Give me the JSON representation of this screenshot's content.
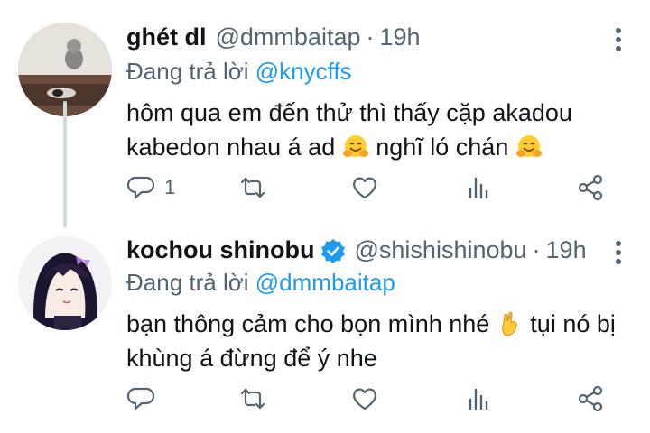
{
  "tweets": [
    {
      "name": "ghét dl",
      "handle": "@dmmbaitap",
      "separator": "·",
      "time": "19h",
      "reply_prefix": "Đang trả lời ",
      "reply_to": "@knycffs",
      "text_part1": "hôm qua em đến thử thì thấy cặp akadou kabedon nhau á ad ",
      "text_part2": " nghĩ ló chán ",
      "emoji": "hugging-face-icon",
      "reply_count": "1",
      "verified": false
    },
    {
      "name": "kochou shinobu",
      "handle": "@shishishinobu",
      "separator": "·",
      "time": "19h",
      "reply_prefix": "Đang trả lời ",
      "reply_to": "@dmmbaitap",
      "text_part1": "bạn thông cảm cho bọn mình nhé ",
      "text_part2": " tụi nó bị khùng á đừng để ý nhe",
      "emoji": "crossed-fingers-icon",
      "reply_count": "",
      "verified": true
    }
  ],
  "colors": {
    "link": "#1d9bf0",
    "muted": "#536471",
    "text": "#0f1419",
    "thread_line": "#cfd9de",
    "emoji": "#ffcc33"
  }
}
